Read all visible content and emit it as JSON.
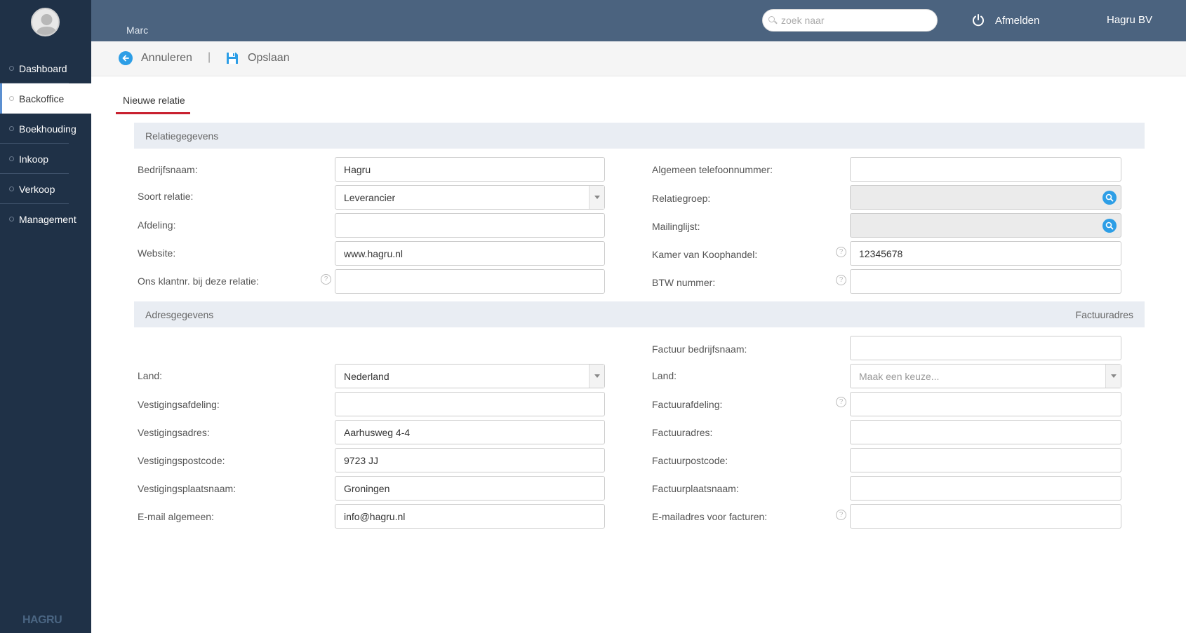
{
  "header": {
    "user_name": "Marc",
    "search_placeholder": "zoek naar",
    "logout_label": "Afmelden",
    "company_name": "Hagru BV"
  },
  "sidebar": {
    "items": [
      {
        "label": "Dashboard"
      },
      {
        "label": "Backoffice",
        "active": true
      },
      {
        "label": "Boekhouding"
      },
      {
        "label": "Inkoop"
      },
      {
        "label": "Verkoop"
      },
      {
        "label": "Management"
      }
    ],
    "logo_text": "HAGRU"
  },
  "toolbar": {
    "cancel_label": "Annuleren",
    "separator": "|",
    "save_label": "Opslaan"
  },
  "tab": {
    "label": "Nieuwe relatie"
  },
  "relatie": {
    "section_title": "Relatiegegevens",
    "bedrijfsnaam": {
      "label": "Bedrijfsnaam:",
      "value": "Hagru"
    },
    "soort_relatie": {
      "label": "Soort relatie:",
      "value": "Leverancier"
    },
    "afdeling": {
      "label": "Afdeling:",
      "value": ""
    },
    "website": {
      "label": "Website:",
      "value": "www.hagru.nl"
    },
    "klantnr": {
      "label": "Ons klantnr. bij deze relatie:",
      "value": ""
    },
    "telefoon": {
      "label": "Algemeen telefoonnummer:",
      "value": ""
    },
    "relatiegroep": {
      "label": "Relatiegroep:",
      "value": ""
    },
    "mailinglijst": {
      "label": "Mailinglijst:",
      "value": ""
    },
    "kvk": {
      "label": "Kamer van Koophandel:",
      "value": "12345678"
    },
    "btw": {
      "label": "BTW nummer:",
      "value": ""
    }
  },
  "adres": {
    "section_title": "Adresgegevens",
    "section_right": "Factuuradres",
    "land": {
      "label": "Land:",
      "value": "Nederland"
    },
    "vestigingsafdeling": {
      "label": "Vestigingsafdeling:",
      "value": ""
    },
    "vestigingsadres": {
      "label": "Vestigingsadres:",
      "value": "Aarhusweg 4-4"
    },
    "vestigingspostcode": {
      "label": "Vestigingspostcode:",
      "value": "9723 JJ"
    },
    "vestigingsplaatsnaam": {
      "label": "Vestigingsplaatsnaam:",
      "value": "Groningen"
    },
    "email": {
      "label": "E-mail algemeen:",
      "value": "info@hagru.nl"
    },
    "factuur_bedrijfsnaam": {
      "label": "Factuur bedrijfsnaam:",
      "value": ""
    },
    "factuur_land": {
      "label": "Land:",
      "placeholder": "Maak een keuze..."
    },
    "factuurafdeling": {
      "label": "Factuurafdeling:",
      "value": ""
    },
    "factuuradres": {
      "label": "Factuuradres:",
      "value": ""
    },
    "factuurpostcode": {
      "label": "Factuurpostcode:",
      "value": ""
    },
    "factuurplaatsnaam": {
      "label": "Factuurplaatsnaam:",
      "value": ""
    },
    "factuur_email": {
      "label": "E-mailadres voor facturen:",
      "value": ""
    }
  },
  "help_glyph": "?"
}
